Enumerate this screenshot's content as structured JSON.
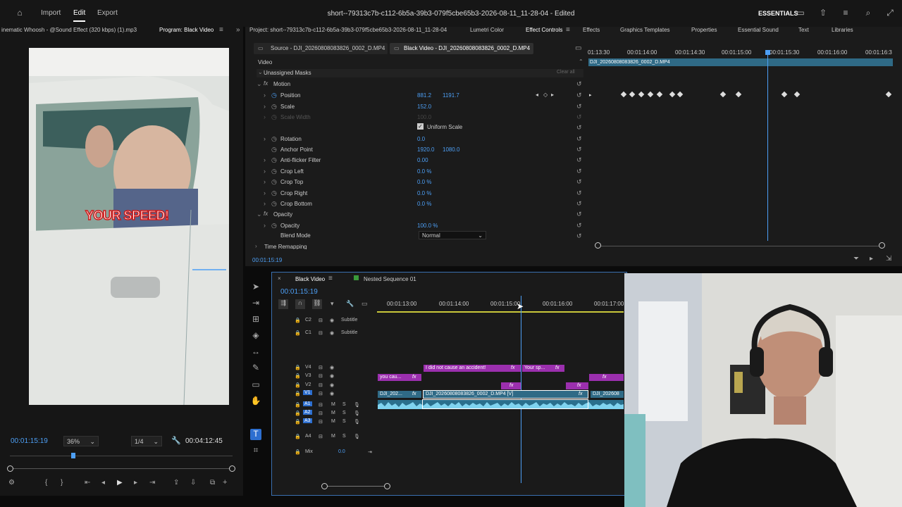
{
  "menu": {
    "import": "Import",
    "edit": "Edit",
    "export": "Export",
    "title": "short--79313c7b-c112-6b5a-39b3-079f5cbe65b3-2026-08-11_11-28-04 - Edited",
    "workspace": "ESSENTIALS"
  },
  "source_tab": {
    "label": "inematic Whoosh - @Sound Effect (320 kbps) (1).mp3",
    "program": "Program: Black Video"
  },
  "tabs": [
    "Project: short--79313c7b-c112-6b5a-39b3-079f5cbe65b3-2026-08-11_11-28-04",
    "Lumetri Color",
    "Effect Controls",
    "Effects",
    "Graphics Templates",
    "Properties",
    "Essential Sound",
    "Text",
    "Libraries"
  ],
  "effect_controls": {
    "source_tab": "Source - DJI_20260808083826_0002_D.MP4",
    "active_tab": "Black Video - DJI_20260808083826_0002_D.MP4",
    "video_label": "Video",
    "masks_label": "Unassigned Masks",
    "clear_all": "Clear all",
    "motion": "Motion",
    "position_label": "Position",
    "position_x": "881.2",
    "position_y": "1191.7",
    "scale_label": "Scale",
    "scale_value": "152.0",
    "scale_width_label": "Scale Width",
    "scale_width_value": "100.0",
    "uniform_scale": "Uniform Scale",
    "rotation_label": "Rotation",
    "rotation_value": "0.0",
    "anchor_label": "Anchor Point",
    "anchor_x": "1920.0",
    "anchor_y": "1080.0",
    "antiflicker_label": "Anti-flicker Filter",
    "antiflicker_value": "0.00",
    "crop_left_label": "Crop Left",
    "crop_left_value": "0.0 %",
    "crop_top_label": "Crop Top",
    "crop_top_value": "0.0 %",
    "crop_right_label": "Crop Right",
    "crop_right_value": "0.0 %",
    "crop_bottom_label": "Crop Bottom",
    "crop_bottom_value": "0.0 %",
    "opacity_section": "Opacity",
    "opacity_label": "Opacity",
    "opacity_value": "100.0 %",
    "blend_label": "Blend Mode",
    "blend_value": "Normal",
    "time_remap": "Time Remapping",
    "timecode": "00:01:15:19",
    "mini_ruler": [
      "01:13:30",
      "00:01:14:00",
      "00:01:14:30",
      "00:01:15:00",
      "00:01:15:30",
      "00:01:16:00",
      "00:01:16:3"
    ],
    "mini_clip": "DJI_20260808083826_0002_D.MP4"
  },
  "program_monitor": {
    "caption": "YOUR SPEED!",
    "timecode": "00:01:15:19",
    "zoom": "36%",
    "quality": "1/4",
    "duration": "00:04:12:45"
  },
  "timeline": {
    "tab1": "Black Video",
    "tab2": "Nested Sequence 01",
    "timecode": "00:01:15:19",
    "ruler": [
      "00:01:13:00",
      "00:01:14:00",
      "00:01:15:00",
      "00:01:16:00",
      "00:01:17:00"
    ],
    "tracks": {
      "c2": "C2",
      "c1": "C1",
      "subtitle": "Subtitle",
      "v4": "V4",
      "v3": "V3",
      "v2": "V2",
      "v1": "V1",
      "a1": "A1",
      "a2": "A2",
      "a3": "A3",
      "a4": "A4",
      "mix": "Mix",
      "mix_value": "0.0",
      "m": "M",
      "s": "S"
    },
    "clips": {
      "c_accident": "I did not cause an accident!",
      "c_yoursp": "Your sp...",
      "c_youcau": "you cau...",
      "c_dji1": "DJI_202...",
      "c_dji_main": "DJI_20260808083826_0002_D.MP4 [V]",
      "c_dji3": "DJI_202608"
    },
    "fx": "fx"
  },
  "colors": {
    "accent": "#4d9ff5",
    "clip_pink": "#9b2fae",
    "clip_teal": "#2f6a86"
  }
}
